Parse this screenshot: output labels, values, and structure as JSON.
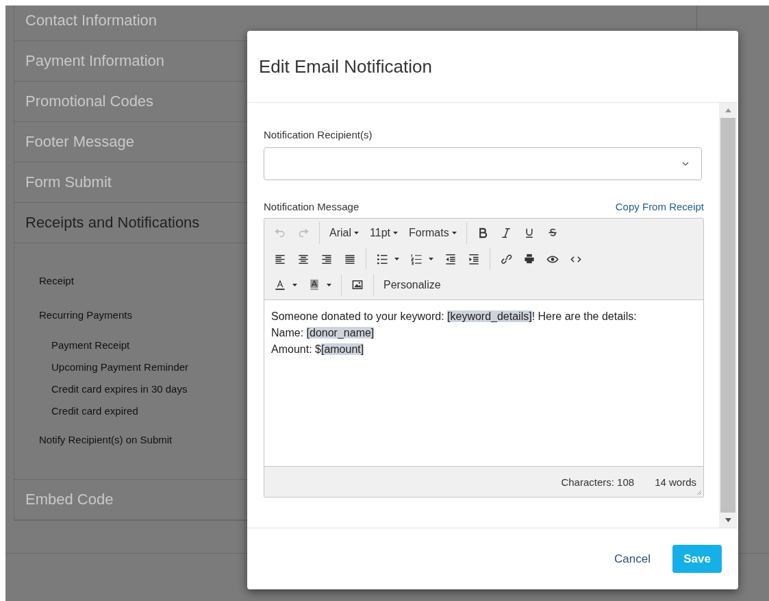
{
  "page": {
    "sections": [
      {
        "title": "Contact Information",
        "expanded": false
      },
      {
        "title": "Payment Information",
        "expanded": false
      },
      {
        "title": "Promotional Codes",
        "expanded": false
      },
      {
        "title": "Footer Message",
        "expanded": false
      },
      {
        "title": "Form Submit",
        "expanded": false
      },
      {
        "title": "Receipts and Notifications",
        "expanded": true,
        "items": [
          {
            "label": "Receipt"
          },
          {
            "label": "Recurring Payments",
            "children": [
              {
                "label": "Payment Receipt"
              },
              {
                "label": "Upcoming Payment Reminder"
              },
              {
                "label": "Credit card expires in 30 days"
              },
              {
                "label": "Credit card expired"
              }
            ]
          },
          {
            "label": "Notify Recipient(s) on Submit"
          }
        ]
      },
      {
        "title": "Embed Code",
        "expanded": false
      }
    ]
  },
  "modal": {
    "title": "Edit Email Notification",
    "recipients": {
      "label": "Notification Recipient(s)"
    },
    "message": {
      "label": "Notification Message",
      "link": "Copy From Receipt",
      "toolbar": [
        [
          [
            {
              "kind": "icon",
              "disabled": true
            },
            {
              "kind": "icon",
              "disabled": true
            }
          ],
          [
            {
              "kind": "dropdown",
              "label": "Arial"
            },
            {
              "kind": "dropdown",
              "label": "11pt"
            },
            {
              "kind": "dropdown",
              "label": "Formats"
            }
          ],
          [
            {
              "kind": "icon",
              "disabled": false
            },
            {
              "kind": "icon",
              "disabled": false
            },
            {
              "kind": "icon",
              "disabled": false
            },
            {
              "kind": "icon",
              "disabled": false
            }
          ]
        ],
        [
          [
            {
              "kind": "icon",
              "disabled": false
            },
            {
              "kind": "icon",
              "disabled": false
            },
            {
              "kind": "icon",
              "disabled": false
            },
            {
              "kind": "icon",
              "disabled": false
            }
          ],
          [
            {
              "kind": "split",
              "disabled": false
            },
            {
              "kind": "split",
              "disabled": false
            },
            {
              "kind": "icon",
              "disabled": false
            },
            {
              "kind": "icon",
              "disabled": false
            }
          ],
          [
            {
              "kind": "icon",
              "disabled": false
            },
            {
              "kind": "icon",
              "disabled": false
            },
            {
              "kind": "icon",
              "disabled": false
            },
            {
              "kind": "icon",
              "disabled": false
            }
          ]
        ],
        [
          [
            {
              "kind": "split",
              "disabled": false
            },
            {
              "kind": "split",
              "disabled": false
            }
          ],
          [
            {
              "kind": "icon",
              "disabled": false
            }
          ],
          [
            {
              "kind": "text",
              "label": "Personalize"
            }
          ]
        ]
      ],
      "lines": [
        [
          {
            "text": "Someone donated to your keyword: "
          },
          {
            "text": "[keyword_details]",
            "kind": "tag"
          },
          {
            "text": "! Here are the details:"
          }
        ],
        [
          {
            "text": "Name: "
          },
          {
            "text": "[donor_name]",
            "kind": "tag"
          }
        ],
        [
          {
            "text": "Amount: $"
          },
          {
            "text": "[amount]",
            "kind": "tag"
          }
        ]
      ],
      "characters": "Characters: 108",
      "words": "14 words"
    },
    "buttons": [
      {
        "label": "Cancel",
        "kind": "link"
      },
      {
        "label": "Save",
        "kind": "primary"
      }
    ]
  }
}
